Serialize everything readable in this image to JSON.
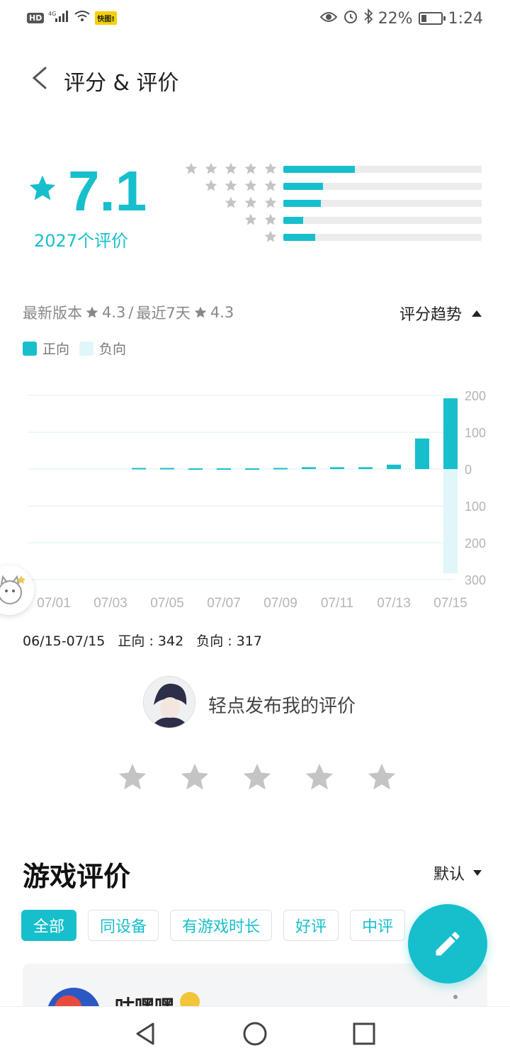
{
  "status_bar": {
    "network": "HD",
    "signal": "4G",
    "app_badge": "快图!",
    "battery": "22%",
    "time": "1:24"
  },
  "header": {
    "title": "评分 & 评价"
  },
  "rating": {
    "score": "7.1",
    "count_text": "2027个评价",
    "distribution": [
      {
        "stars": 5,
        "fraction": 0.36
      },
      {
        "stars": 4,
        "fraction": 0.2
      },
      {
        "stars": 3,
        "fraction": 0.19
      },
      {
        "stars": 2,
        "fraction": 0.1
      },
      {
        "stars": 1,
        "fraction": 0.16
      }
    ]
  },
  "version_info": {
    "latest_label": "最新版本",
    "latest_score": "4.3",
    "sep": "/",
    "recent_label": "最近7天",
    "recent_score": "4.3"
  },
  "trend": {
    "label": "评分趋势"
  },
  "legend": {
    "positive": "正向",
    "negative": "负向"
  },
  "chart_data": {
    "type": "bar",
    "categories": [
      "07/01",
      "07/02",
      "07/03",
      "07/04",
      "07/05",
      "07/06",
      "07/07",
      "07/08",
      "07/09",
      "07/10",
      "07/11",
      "07/12",
      "07/13",
      "07/14",
      "07/15"
    ],
    "x_tick_labels": [
      "07/01",
      "07/03",
      "07/05",
      "07/07",
      "07/09",
      "07/11",
      "07/13",
      "07/15"
    ],
    "y_tick_labels": [
      "200",
      "100",
      "0",
      "100",
      "200",
      "300"
    ],
    "ylim": [
      -300,
      200
    ],
    "series": [
      {
        "name": "正向",
        "color": "#17bfcc",
        "values": [
          0,
          0,
          0,
          3,
          3,
          2,
          2,
          2,
          3,
          5,
          5,
          5,
          12,
          83,
          192
        ]
      },
      {
        "name": "负向",
        "color": "#e0f6f8",
        "values": [
          0,
          0,
          0,
          0,
          0,
          0,
          0,
          0,
          0,
          0,
          0,
          0,
          0,
          0,
          -283
        ]
      }
    ]
  },
  "period": {
    "range": "06/15-07/15",
    "positive": "正向 : 342",
    "negative": "负向 : 317"
  },
  "my_review": {
    "prompt": "轻点发布我的评价"
  },
  "reviews": {
    "title": "游戏评价",
    "sort": "默认",
    "filters": [
      "全部",
      "同设备",
      "有游戏时长",
      "好评",
      "中评"
    ],
    "first_user": "咕嘿嘿"
  },
  "colors": {
    "accent": "#17bfcc",
    "negative": "#e0f6f8",
    "star_gray": "#bdbdbd"
  }
}
